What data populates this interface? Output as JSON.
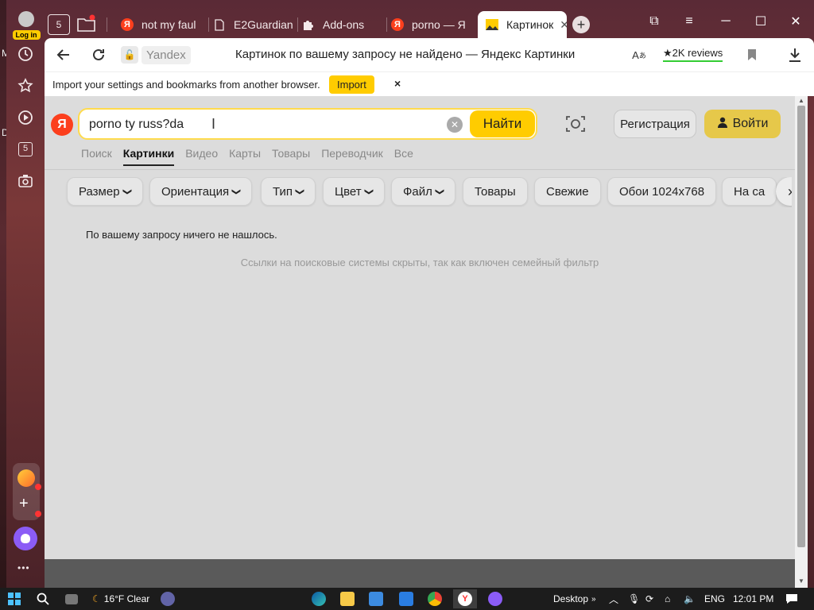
{
  "desktop": {
    "letters": [
      "M",
      "D"
    ]
  },
  "sidebar": {
    "login_label": "Log in",
    "tab_counter": "5",
    "items": [
      {
        "name": "history-icon",
        "glyph": "◷"
      },
      {
        "name": "bookmarks-star-icon",
        "glyph": "☆"
      },
      {
        "name": "media-play-icon",
        "glyph": "▷"
      },
      {
        "name": "collections-icon",
        "glyph": "5"
      },
      {
        "name": "screenshot-icon",
        "glyph": "⌘"
      }
    ],
    "more": "•••"
  },
  "tabs": [
    {
      "title": "not my faul",
      "favicon": "yandex"
    },
    {
      "title": "E2Guardian",
      "favicon": "doc"
    },
    {
      "title": "Add-ons",
      "favicon": "puzzle"
    },
    {
      "title": "porno — Я",
      "favicon": "yandex"
    },
    {
      "title": "Картинок",
      "favicon": "image",
      "active": true
    }
  ],
  "tabs_home_counter": "5",
  "window_controls": {
    "minimize": "─",
    "maximize": "☐",
    "close": "✕",
    "menu": "≡",
    "collections": "⧉"
  },
  "address_bar": {
    "domain": "Yandex",
    "title": "Картинок по вашему запросу не найдено — Яндекс Картинки",
    "reviews": "★2K reviews"
  },
  "import_bar": {
    "text": "Import your settings and bookmarks from another browser.",
    "button": "Import",
    "close": "×"
  },
  "search": {
    "logo": "Я",
    "query": "porno ty russ?da",
    "submit": "Найти",
    "register": "Регистрация",
    "login": "Войти"
  },
  "nav_tabs": [
    "Поиск",
    "Картинки",
    "Видео",
    "Карты",
    "Товары",
    "Переводчик",
    "Все"
  ],
  "nav_active": "Картинки",
  "filters": [
    {
      "label": "Размер",
      "dropdown": true
    },
    {
      "label": "Ориентация",
      "dropdown": true
    },
    {
      "label": "Тип",
      "dropdown": true
    },
    {
      "label": "Цвет",
      "dropdown": true
    },
    {
      "label": "Файл",
      "dropdown": true
    },
    {
      "label": "Товары",
      "dropdown": false
    },
    {
      "label": "Свежие",
      "dropdown": false
    },
    {
      "label": "Обои 1024x768",
      "dropdown": false
    },
    {
      "label": "На са",
      "dropdown": false
    }
  ],
  "results": {
    "not_found": "По вашему запросу ничего не нашлось.",
    "family_filter": "Ссылки на поисковые системы скрыты, так как включен семейный фильтр"
  },
  "taskbar": {
    "weather": "16°F Clear",
    "desktop_label": "Desktop",
    "language": "ENG",
    "time": "12:01 PM"
  }
}
